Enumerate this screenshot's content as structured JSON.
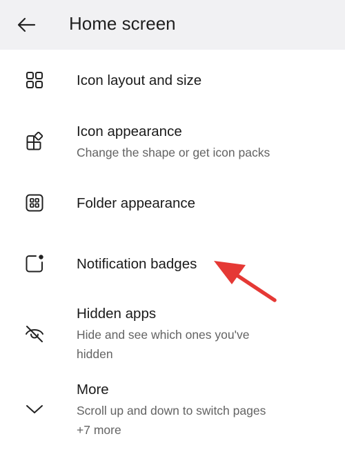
{
  "header": {
    "title": "Home screen",
    "back_icon": "arrow-left-icon"
  },
  "items": [
    {
      "icon": "grid-four-squares-icon",
      "title": "Icon layout and size",
      "subtitle": ""
    },
    {
      "icon": "shape-squares-icon",
      "title": "Icon appearance",
      "subtitle": "Change the shape or get icon packs"
    },
    {
      "icon": "folder-grid-icon",
      "title": "Folder appearance",
      "subtitle": ""
    },
    {
      "icon": "notification-badge-icon",
      "title": "Notification badges",
      "subtitle": ""
    },
    {
      "icon": "eye-off-icon",
      "title": "Hidden apps",
      "subtitle": "Hide and see which ones you've hidden"
    },
    {
      "icon": "chevron-down-icon",
      "title": "More",
      "subtitle": "Scroll up and down to switch pages",
      "extra": "+7 more"
    }
  ],
  "annotation": {
    "color": "#e53935",
    "icon": "red-pointer-arrow"
  }
}
